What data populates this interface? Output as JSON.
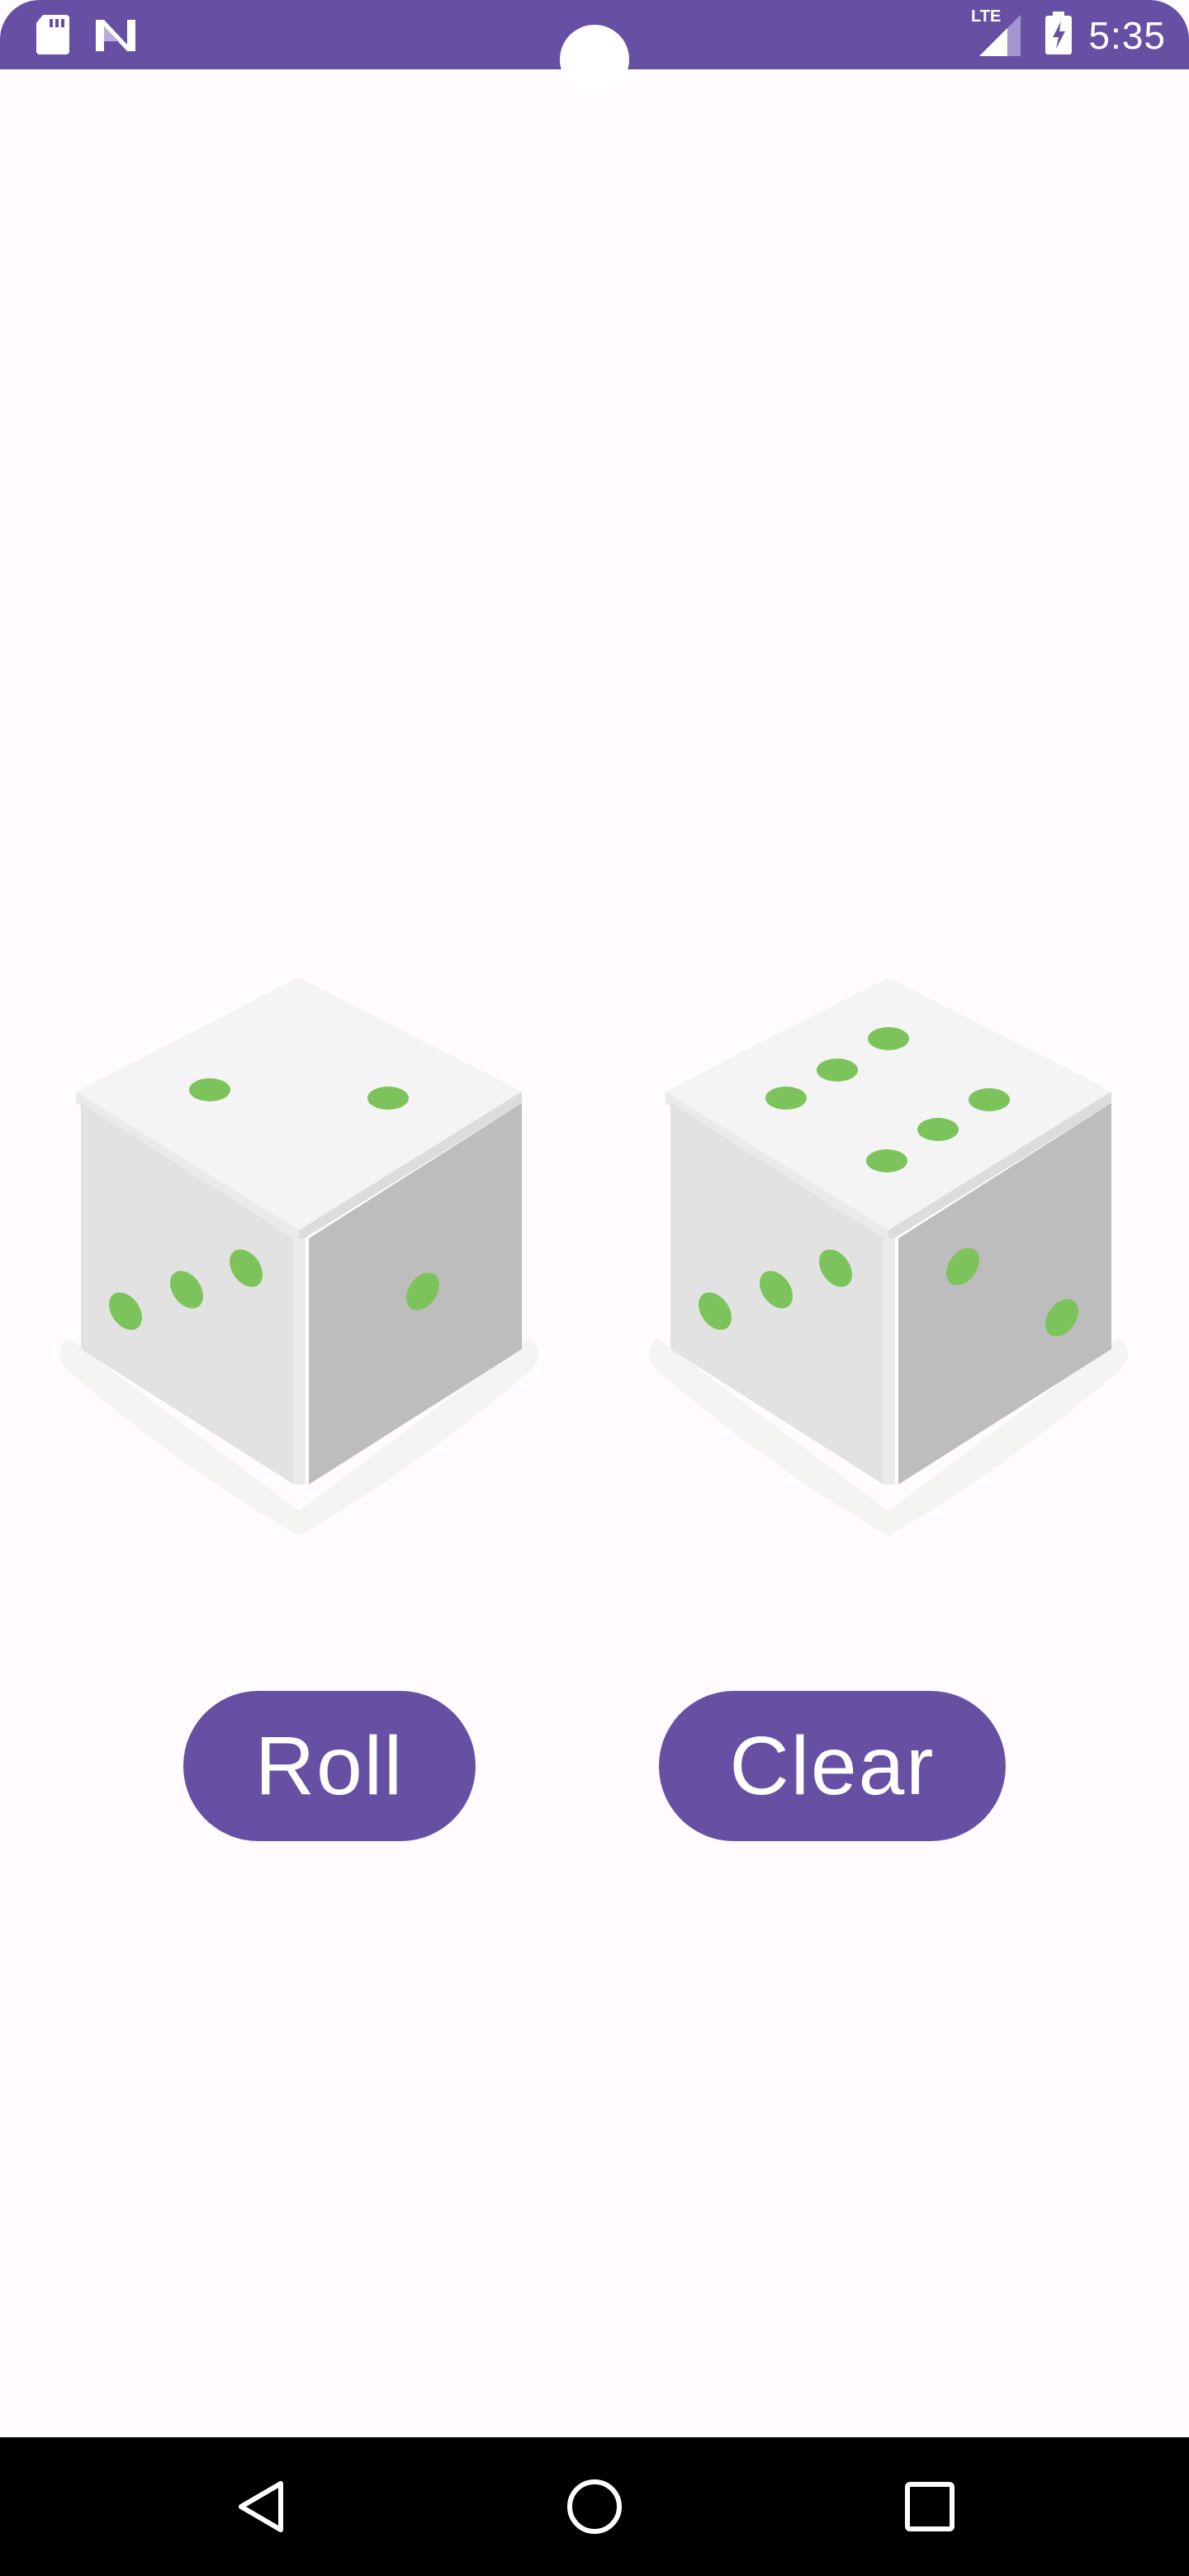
{
  "status_bar": {
    "time": "5:35",
    "network_label": "LTE",
    "bar_color": "#6750a4",
    "icons": [
      "sd-card-icon",
      "app-n-icon",
      "lte-signal-icon",
      "battery-charging-icon"
    ]
  },
  "dice": {
    "left": {
      "top_pips": 2,
      "left_face_pips": 3,
      "right_face_pips": 1
    },
    "right": {
      "top_pips": 6,
      "left_face_pips": 3,
      "right_face_pips": 2
    },
    "pip_color": "#7dc35b"
  },
  "buttons": {
    "roll_label": "Roll",
    "clear_label": "Clear",
    "color": "#6750a4"
  },
  "nav_bar": {
    "icons": [
      "back-icon",
      "home-icon",
      "recents-icon"
    ]
  }
}
